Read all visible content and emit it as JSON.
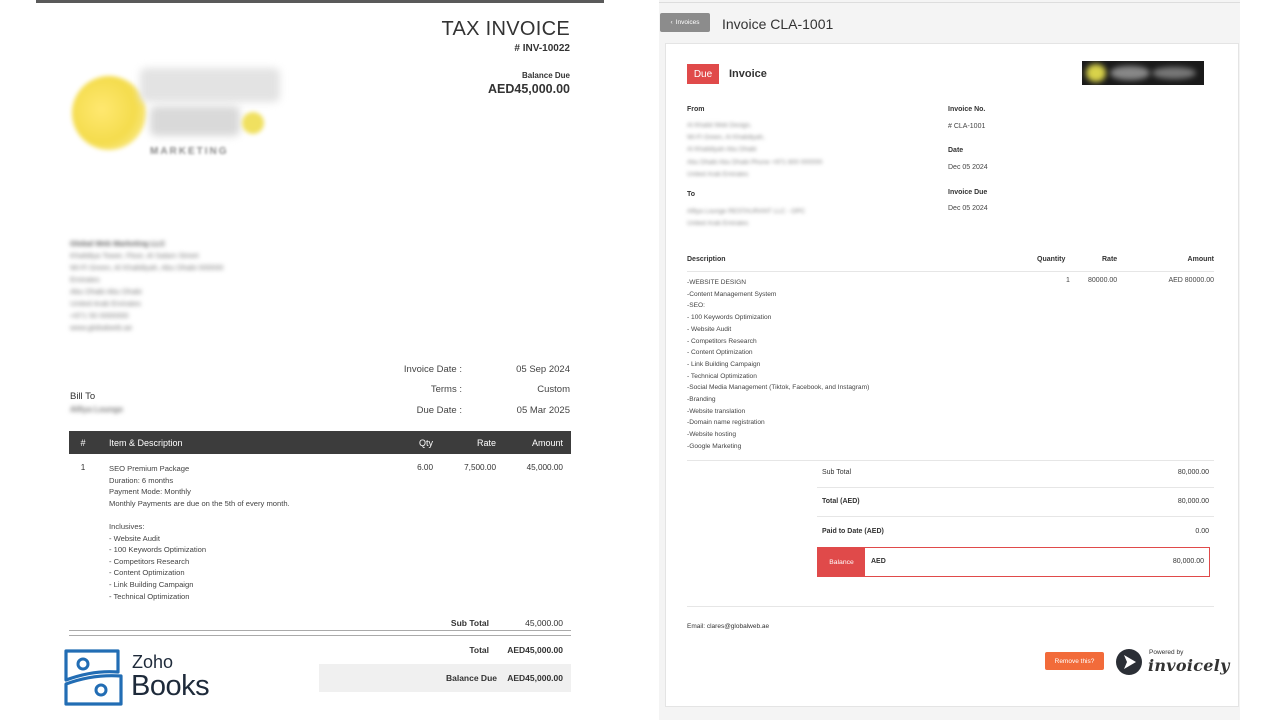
{
  "zoho_invoice": {
    "title": "TAX INVOICE",
    "number": "# INV-10022",
    "balance_due_label": "Balance Due",
    "balance_due": "AED45,000.00",
    "logo_subtitle": "MARKETING",
    "company_address": [
      "Global Web Marketing LLC",
      "Khalidiya Tower, Floor, Al Salam Street",
      "Wi-Fi Green, Al Khalidiyah, Abu Dhabi 000000",
      "Emirates",
      "Abu Dhabi Abu Dhabi",
      "United Arab Emirates",
      "+971 50 0000000",
      "www.globalweb.ae"
    ],
    "meta": [
      {
        "label": "Invoice Date :",
        "value": "05 Sep 2024"
      },
      {
        "label": "Terms :",
        "value": "Custom"
      },
      {
        "label": "Due Date :",
        "value": "05 Mar 2025"
      }
    ],
    "bill_to_label": "Bill To",
    "bill_to_name": "Alfiya Lounge",
    "table_headers": {
      "num": "#",
      "item": "Item & Description",
      "qty": "Qty",
      "rate": "Rate",
      "amount": "Amount"
    },
    "line": {
      "num": "1",
      "description": [
        "SEO Premium Package",
        "Duration: 6 months",
        "Payment Mode: Monthly",
        "Monthly Payments are due on the 5th of every month.",
        "",
        "Inclusives:",
        "- Website Audit",
        "- 100 Keywords Optimization",
        "- Competitors Research",
        "- Content Optimization",
        "- Link Building Campaign",
        "- Technical Optimization"
      ],
      "qty": "6.00",
      "rate": "7,500.00",
      "amount": "45,000.00"
    },
    "sub_total_label": "Sub Total",
    "sub_total": "45,000.00",
    "total_label": "Total",
    "total": "AED45,000.00",
    "final_balance_label": "Balance Due",
    "final_balance": "AED45,000.00",
    "brand": {
      "line1": "Zoho",
      "line2": "Books",
      "color": "#226DB4"
    }
  },
  "invoicely": {
    "back_label": "Invoices",
    "heading": "Invoice CLA-1001",
    "status_badge": "Due",
    "card_title": "Invoice",
    "from_label": "From",
    "from_lines": [
      "Al Khalid Web Design,",
      "Wi-Fi Green, Al Khalidiyah,",
      "Al Khalidiyah Abu Dhabi",
      "Abu Dhabi Abu Dhabi Phone +971 800 000000",
      "United Arab Emirates"
    ],
    "to_label": "To",
    "to_lines": [
      "Alfiya Lounge RESTAURANT LLC - OPC",
      "United Arab Emirates"
    ],
    "invoice_no_label": "Invoice No.",
    "invoice_no": "# CLA-1001",
    "date_label": "Date",
    "date": "Dec 05 2024",
    "due_label": "Invoice Due",
    "due": "Dec 05 2024",
    "table_headers": {
      "description": "Description",
      "quantity": "Quantity",
      "rate": "Rate",
      "amount": "Amount"
    },
    "line": {
      "description": [
        "-WEBSITE DESIGN",
        "-Content Management System",
        "-SEO:",
        "- 100 Keywords Optimization",
        "- Website Audit",
        "- Competitors Research",
        "- Content Optimization",
        "- Link Building Campaign",
        "- Technical Optimization",
        "-Social Media Management (Tiktok, Facebook, and Instagram)",
        "-Branding",
        "-Website translation",
        "-Domain name registration",
        "-Website hosting",
        "-Google Marketing"
      ],
      "quantity": "1",
      "rate": "80000.00",
      "amount": "AED 80000.00"
    },
    "sub_total_label": "Sub Total",
    "sub_total": "80,000.00",
    "total_label": "Total (AED)",
    "total": "80,000.00",
    "paid_label": "Paid to Date (AED)",
    "paid": "0.00",
    "balance_label": "Balance",
    "balance_currency": "AED",
    "balance": "80,000.00",
    "email": "Email: clares@globalweb.ae",
    "remove_label": "Remove this?",
    "powered_by": "Powered by",
    "powered_name": "invoicely",
    "accent": "#E04A4A"
  }
}
